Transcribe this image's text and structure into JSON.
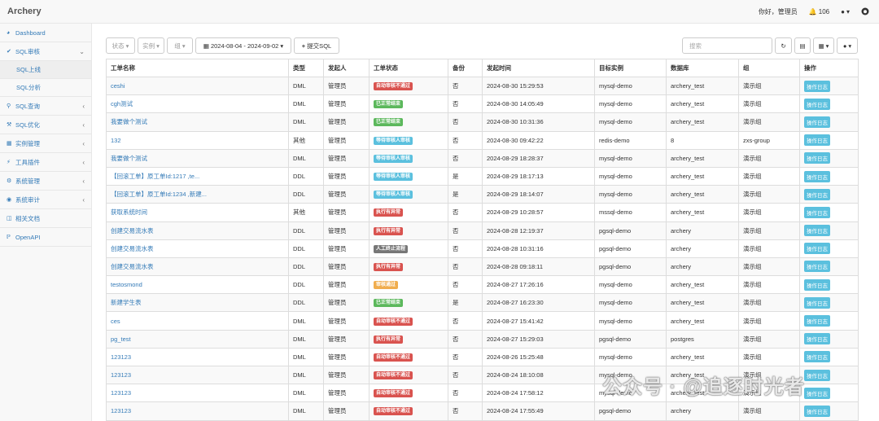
{
  "app": {
    "brand": "Archery"
  },
  "topbar": {
    "greeting": "你好，管理员",
    "notifications": "106"
  },
  "sidebar": {
    "items": [
      {
        "label": "Dashboard",
        "icon": "dashboard-icon"
      },
      {
        "label": "SQL审核",
        "icon": "check-icon"
      },
      {
        "label": "SQL上线"
      },
      {
        "label": "SQL分析"
      },
      {
        "label": "SQL查询",
        "icon": "search-icon"
      },
      {
        "label": "SQL优化",
        "icon": "wrench-icon"
      },
      {
        "label": "实例管理",
        "icon": "table-icon"
      },
      {
        "label": "工具插件",
        "icon": "plug-icon"
      },
      {
        "label": "系统管理",
        "icon": "gears-icon"
      },
      {
        "label": "系统审计",
        "icon": "eye-icon"
      },
      {
        "label": "相关文档",
        "icon": "sitemap-icon"
      },
      {
        "label": "OpenAPI",
        "icon": "api-icon"
      }
    ]
  },
  "toolbar": {
    "status_filter": "状态",
    "instance_filter": "实例",
    "group_filter": "组",
    "date_range": "2024-08-04 - 2024-09-02",
    "submit_label": "提交SQL",
    "search_placeholder": "搜索"
  },
  "table": {
    "headers": [
      "工单名称",
      "类型",
      "发起人",
      "工单状态",
      "备份",
      "发起时间",
      "目标实例",
      "数据库",
      "组",
      "操作"
    ],
    "rows": [
      [
        "ceshi",
        "DML",
        "管理员",
        "自动审核不通过",
        "否",
        "2024-08-30 15:29:53",
        "mysql-demo",
        "archery_test",
        "演示组",
        "操作日志"
      ],
      [
        "cgh测试",
        "DML",
        "管理员",
        "已正常结束",
        "否",
        "2024-08-30 14:05:49",
        "mysql-demo",
        "archery_test",
        "演示组",
        "操作日志"
      ],
      [
        "我要做个测试",
        "DML",
        "管理员",
        "已正常结束",
        "否",
        "2024-08-30 10:31:36",
        "mysql-demo",
        "archery_test",
        "演示组",
        "操作日志"
      ],
      [
        "132",
        "其他",
        "管理员",
        "等待审核人审核",
        "否",
        "2024-08-30 09:42:22",
        "redis-demo",
        "8",
        "zxs-group",
        "操作日志"
      ],
      [
        "我要做个测试",
        "DML",
        "管理员",
        "等待审核人审核",
        "否",
        "2024-08-29 18:28:37",
        "mysql-demo",
        "archery_test",
        "演示组",
        "操作日志"
      ],
      [
        "【回滚工单】原工单Id:1217 ,te...",
        "DDL",
        "管理员",
        "等待审核人审核",
        "是",
        "2024-08-29 18:17:13",
        "mysql-demo",
        "archery_test",
        "演示组",
        "操作日志"
      ],
      [
        "【回滚工单】原工单Id:1234 ,新建...",
        "DDL",
        "管理员",
        "等待审核人审核",
        "是",
        "2024-08-29 18:14:07",
        "mysql-demo",
        "archery_test",
        "演示组",
        "操作日志"
      ],
      [
        "获取系统时间",
        "其他",
        "管理员",
        "执行有异常",
        "否",
        "2024-08-29 10:28:57",
        "mssql-demo",
        "archery_test",
        "演示组",
        "操作日志"
      ],
      [
        "创建交易流水表",
        "DDL",
        "管理员",
        "执行有异常",
        "否",
        "2024-08-28 12:19:37",
        "pgsql-demo",
        "archery",
        "演示组",
        "操作日志"
      ],
      [
        "创建交易流水表",
        "DDL",
        "管理员",
        "人工终止流程",
        "否",
        "2024-08-28 10:31:16",
        "pgsql-demo",
        "archery",
        "演示组",
        "操作日志"
      ],
      [
        "创建交易流水表",
        "DDL",
        "管理员",
        "执行有异常",
        "否",
        "2024-08-28 09:18:11",
        "pgsql-demo",
        "archery",
        "演示组",
        "操作日志"
      ],
      [
        "testosmond",
        "DDL",
        "管理员",
        "审核通过",
        "否",
        "2024-08-27 17:26:16",
        "mysql-demo",
        "archery_test",
        "演示组",
        "操作日志"
      ],
      [
        "新建学生表",
        "DDL",
        "管理员",
        "已正常结束",
        "是",
        "2024-08-27 16:23:30",
        "mysql-demo",
        "archery_test",
        "演示组",
        "操作日志"
      ],
      [
        "ces",
        "DML",
        "管理员",
        "自动审核不通过",
        "否",
        "2024-08-27 15:41:42",
        "mysql-demo",
        "archery_test",
        "演示组",
        "操作日志"
      ],
      [
        "pg_test",
        "DML",
        "管理员",
        "执行有异常",
        "否",
        "2024-08-27 15:29:03",
        "pgsql-demo",
        "postgres",
        "演示组",
        "操作日志"
      ],
      [
        "123123",
        "DML",
        "管理员",
        "自动审核不通过",
        "否",
        "2024-08-26 15:25:48",
        "mysql-demo",
        "archery_test",
        "演示组",
        "操作日志"
      ],
      [
        "123123",
        "DML",
        "管理员",
        "自动审核不通过",
        "否",
        "2024-08-24 18:10:08",
        "mysql-demo",
        "archery_test",
        "演示组",
        "操作日志"
      ],
      [
        "123123",
        "DML",
        "管理员",
        "自动审核不通过",
        "否",
        "2024-08-24 17:58:12",
        "mysql-demo",
        "archery_test",
        "演示组",
        "操作日志"
      ],
      [
        "123123",
        "DML",
        "管理员",
        "自动审核不通过",
        "否",
        "2024-08-24 17:55:49",
        "pgsql-demo",
        "archery",
        "演示组",
        "操作日志"
      ]
    ]
  },
  "status_colors": {
    "自动审核不通过": "#d9534f",
    "已正常结束": "#5cb85c",
    "等待审核人审核": "#5bc0de",
    "执行有异常": "#d9534f",
    "人工终止流程": "#777777",
    "审核通过": "#f0ad4e"
  },
  "watermark": "公众号 · @追逐时光者"
}
